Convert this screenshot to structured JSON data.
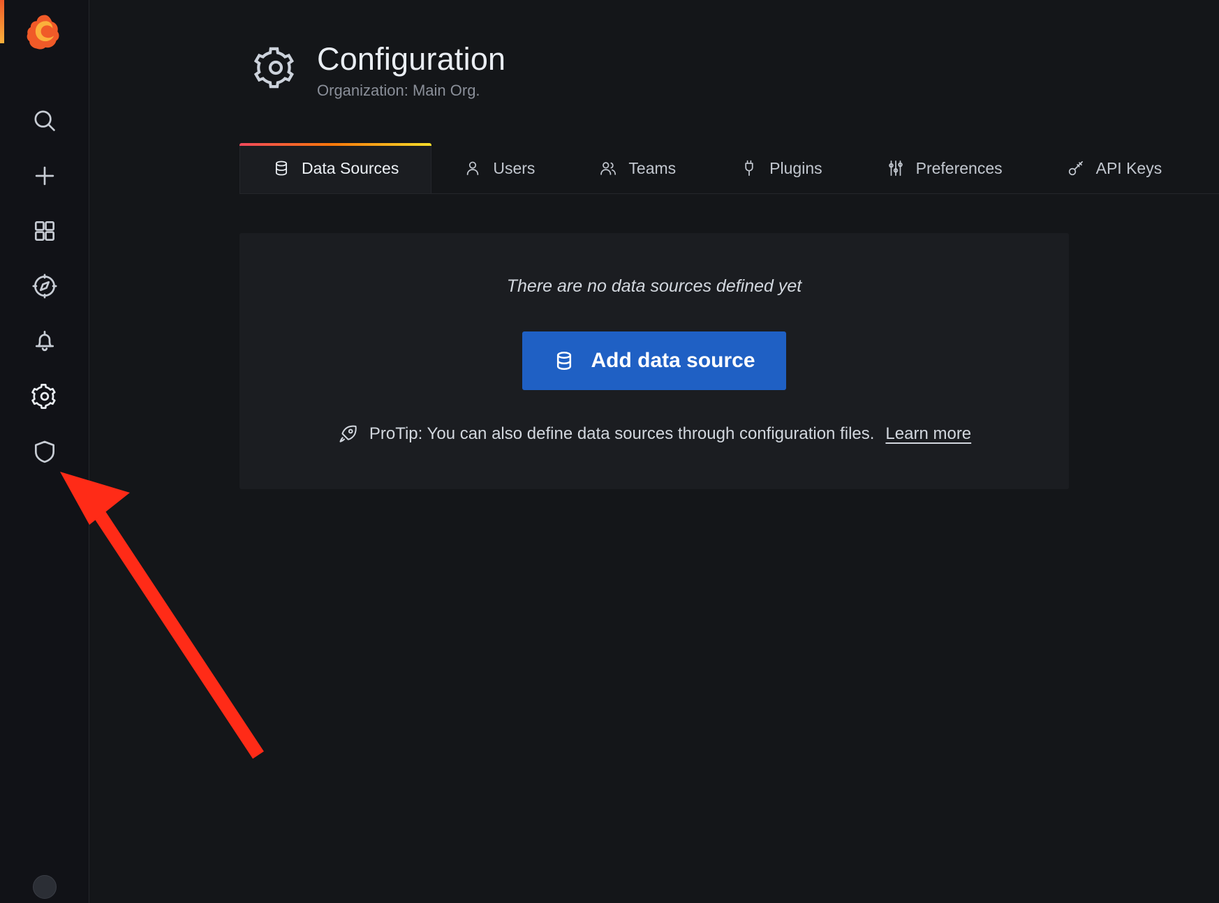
{
  "app": {
    "name": "Grafana",
    "logo_icon": "grafana-logo-icon"
  },
  "sidebar": {
    "items": [
      {
        "label": "Search",
        "icon": "search-icon",
        "name": "sidebar-item-search",
        "active": false
      },
      {
        "label": "Create",
        "icon": "plus-icon",
        "name": "sidebar-item-create",
        "active": false
      },
      {
        "label": "Dashboards",
        "icon": "dashboards-grid-icon",
        "name": "sidebar-item-dashboards",
        "active": false
      },
      {
        "label": "Explore",
        "icon": "compass-icon",
        "name": "sidebar-item-explore",
        "active": false
      },
      {
        "label": "Alerting",
        "icon": "bell-icon",
        "name": "sidebar-item-alerting",
        "active": false
      },
      {
        "label": "Configuration",
        "icon": "gear-icon",
        "name": "sidebar-item-configuration",
        "active": true
      },
      {
        "label": "Server Admin",
        "icon": "shield-icon",
        "name": "sidebar-item-server-admin",
        "active": false
      }
    ],
    "profile": {
      "label": "User profile",
      "icon": "avatar-icon"
    }
  },
  "header": {
    "icon": "gear-icon",
    "title": "Configuration",
    "subtitle": "Organization: Main Org."
  },
  "tabs": [
    {
      "label": "Data Sources",
      "icon": "database-icon",
      "name": "tab-data-sources",
      "active": true
    },
    {
      "label": "Users",
      "icon": "user-icon",
      "name": "tab-users",
      "active": false
    },
    {
      "label": "Teams",
      "icon": "users-icon",
      "name": "tab-teams",
      "active": false
    },
    {
      "label": "Plugins",
      "icon": "plug-icon",
      "name": "tab-plugins",
      "active": false
    },
    {
      "label": "Preferences",
      "icon": "sliders-icon",
      "name": "tab-preferences",
      "active": false
    },
    {
      "label": "API Keys",
      "icon": "key-icon",
      "name": "tab-api-keys",
      "active": false
    }
  ],
  "main": {
    "empty_message": "There are no data sources defined yet",
    "add_button_label": "Add data source",
    "add_button_icon": "database-icon",
    "protip_icon": "rocket-icon",
    "protip_text": "ProTip: You can also define data sources through configuration files.",
    "protip_link_label": "Learn more"
  },
  "annotation": {
    "type": "arrow",
    "color": "#ff2b17",
    "points_to": "sidebar-item-configuration"
  },
  "colors": {
    "accent_gradient_start": "#f2495c",
    "accent_gradient_mid": "#ff780a",
    "accent_gradient_end": "#fade2a",
    "primary_button": "#1f60c4",
    "background": "#141619",
    "panel": "#1b1d21",
    "sidebar": "#111217",
    "annotation": "#ff2b17"
  }
}
